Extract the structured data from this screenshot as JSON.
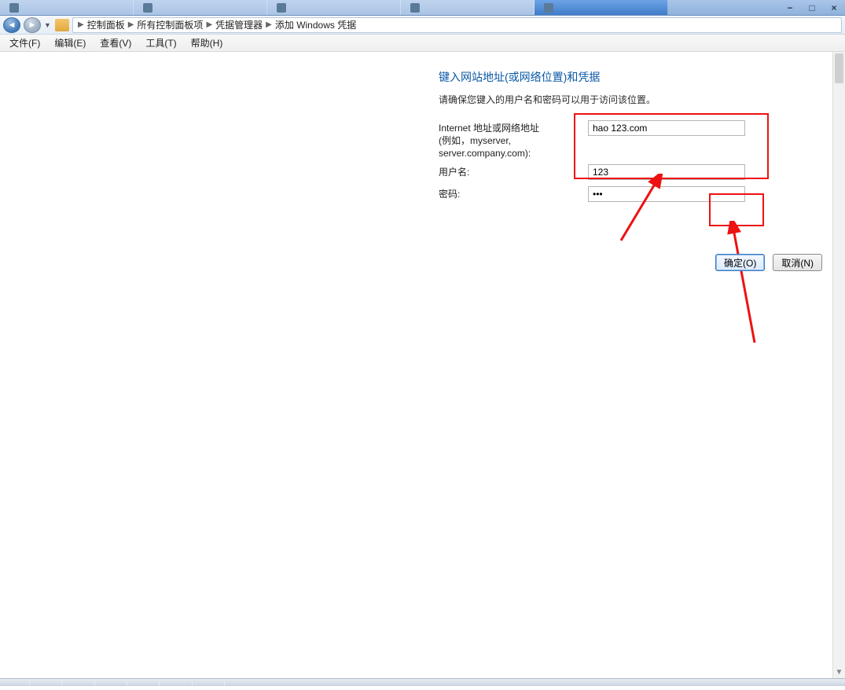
{
  "tabs": {
    "t1": "",
    "t2": "",
    "t3": "",
    "t4": "",
    "t5": ""
  },
  "breadcrumb": {
    "b1": "控制面板",
    "b2": "所有控制面板项",
    "b3": "凭据管理器",
    "b4": "添加 Windows 凭据"
  },
  "menu": {
    "file": "文件(F)",
    "edit": "编辑(E)",
    "view": "查看(V)",
    "tools": "工具(T)",
    "help": "帮助(H)"
  },
  "page": {
    "title": "键入网站地址(或网络位置)和凭据",
    "subtitle": "请确保您键入的用户名和密码可以用于访问该位置。",
    "addr_label": "Internet 地址或网络地址",
    "addr_hint": "(例如，myserver, server.company.com):",
    "user_label": "用户名:",
    "pass_label": "密码:",
    "addr_value": "hao 123.com",
    "user_value": "123",
    "pass_value": "•••"
  },
  "buttons": {
    "ok": "确定(O)",
    "cancel": "取消(N)"
  }
}
